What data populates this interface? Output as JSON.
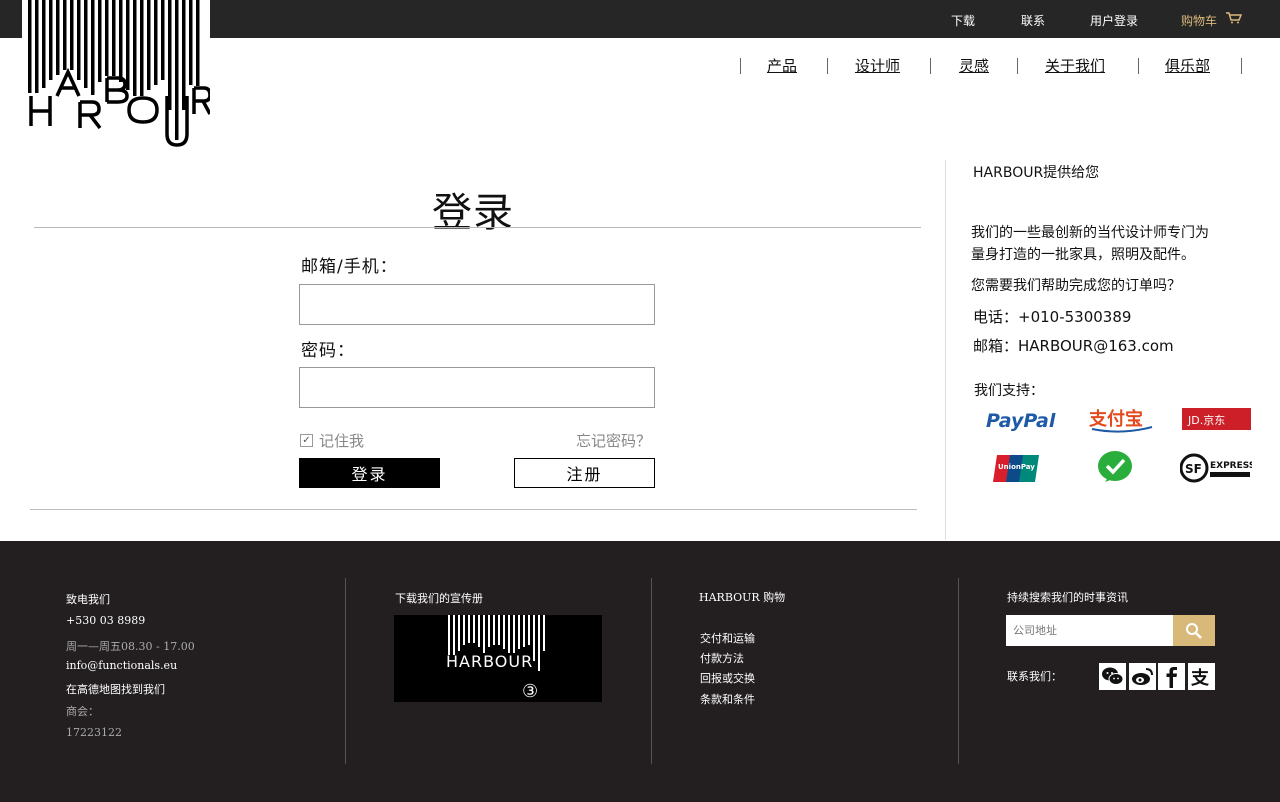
{
  "topbar": {
    "download": "下载",
    "contact": "联系",
    "user_login": "用户登录",
    "cart": "购物车"
  },
  "logo": {
    "text": "HARBOUR"
  },
  "nav": {
    "items": [
      "产品",
      "设计师",
      "灵感",
      "关于我们",
      "俱乐部"
    ]
  },
  "login": {
    "title": "登录",
    "email_label": "邮箱/手机：",
    "email_value": "",
    "password_label": "密码：",
    "password_value": "",
    "remember_label": "记住我",
    "forgot_label": "忘记密码？",
    "login_button": "登录",
    "register_button": "注册"
  },
  "sidebar": {
    "heading": "HARBOUR提供给您",
    "desc_line1": "我们的一些最创新的当代设计师专门为",
    "desc_line2": "量身打造的一批家具，照明及配件。",
    "help": "您需要我们帮助完成您的订单吗？",
    "phone": "电话：+010-5300389",
    "email": "邮箱：HARBOUR@163.com",
    "support_label": "我们支持：",
    "payments": [
      {
        "icon": "paypal-icon",
        "text": "PayPal",
        "color": "#1f5aa6"
      },
      {
        "icon": "alipay-icon",
        "text": "支付宝",
        "color": "#e34a1f"
      },
      {
        "icon": "jd-icon",
        "text": "JD.京东",
        "color": "#cc1f27"
      },
      {
        "icon": "unionpay-icon",
        "text": "UnionPay",
        "color": "#0d4a8a"
      },
      {
        "icon": "wechat-pay-icon",
        "text": "",
        "color": "#2aae3b"
      },
      {
        "icon": "sf-express-icon",
        "text": "EXPRESS",
        "color": "#111111"
      }
    ]
  },
  "footer": {
    "col1": {
      "title": "致电我们",
      "phone": "+530 03 8989",
      "hours": "周一—周五08.30 - 17.00",
      "email": "info@functionals.eu",
      "map": "在高德地图找到我们",
      "meeting_label": "商会：",
      "meeting_number": "17223122"
    },
    "col2": {
      "title": "下载我们的宣传册",
      "brochure_logo": "HARBOUR",
      "brochure_mark": "③"
    },
    "col3": {
      "title": "HARBOUR 购物",
      "links": [
        "交付和运输",
        "付款方法",
        "回报或交换",
        "条款和条件"
      ]
    },
    "col4": {
      "title": "持续搜索我们的时事资讯",
      "search_placeholder": "公司地址",
      "follow_label": "联系我们："
    }
  },
  "colors": {
    "dark": "#262626",
    "footer": "#231f20",
    "accent": "#d9b97a"
  }
}
